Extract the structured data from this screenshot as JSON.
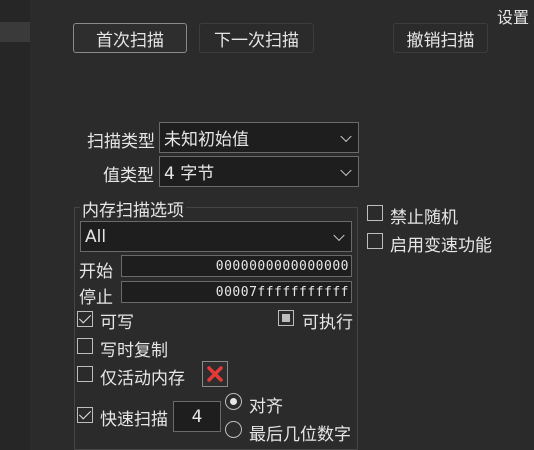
{
  "header": {
    "settings_label": "设置"
  },
  "toolbar": {
    "first_scan": "首次扫描",
    "next_scan": "下一次扫描",
    "undo_scan": "撤销扫描"
  },
  "scan": {
    "scan_type_label": "扫描类型",
    "scan_type_value": "未知初始值",
    "value_type_label": "值类型",
    "value_type_value": "4 字节"
  },
  "memory_options": {
    "title": "内存扫描选项",
    "region_value": "All",
    "start_label": "开始",
    "start_value": "0000000000000000",
    "stop_label": "停止",
    "stop_value": "00007fffffffffff",
    "writable_label": "可写",
    "writable_checked": true,
    "executable_label": "可执行",
    "executable_state": "partial",
    "copy_on_write_label": "写时复制",
    "copy_on_write_checked": false,
    "active_only_label": "仅活动内存",
    "active_only_checked": false,
    "fast_scan_label": "快速扫描",
    "fast_scan_checked": true,
    "fast_scan_value": "4",
    "align_label": "对齐",
    "align_selected": true,
    "last_digits_label": "最后几位数字",
    "last_digits_selected": false
  },
  "side_options": {
    "disable_random_label": "禁止随机",
    "disable_random_checked": false,
    "speedhack_label": "启用变速功能",
    "speedhack_checked": false
  },
  "colors": {
    "background": "#2b2b2b",
    "text": "#e6e6e6",
    "close_red": "#e53935"
  }
}
